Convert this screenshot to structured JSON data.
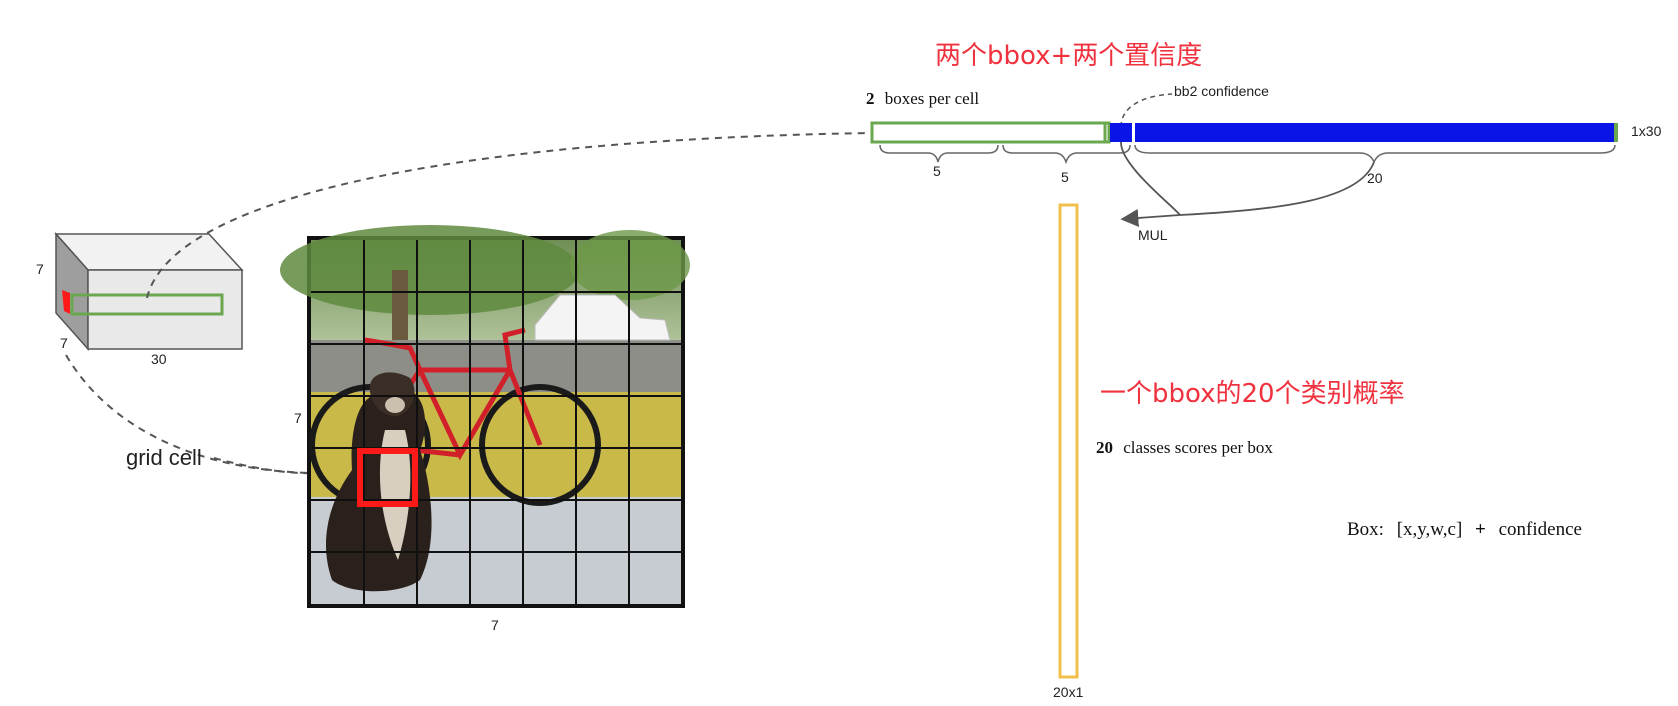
{
  "colors": {
    "green": "#6aa84f",
    "blue": "#0a14e6",
    "orange": "#f2c04a",
    "red": "#ff1a1a",
    "annotation_red": "#f0323f",
    "dashed": "#555555"
  },
  "cube": {
    "height_label": "7",
    "depth_label": "7",
    "width_label": "30"
  },
  "image": {
    "grid_label_y": "7",
    "grid_label_x": "7",
    "grid_cell_label": "grid cell"
  },
  "vector": {
    "title_cn": "两个bbox+两个置信度",
    "boxes_count": "2",
    "boxes_label": "boxes per cell",
    "bb2_label": "bb2 confidence",
    "size_label": "1x30",
    "seg1_label": "5",
    "seg2_label": "5",
    "seg3_label": "20",
    "mul_label": "MUL"
  },
  "class_vector": {
    "title_cn": "一个bbox的20个类别概率",
    "classes_count": "20",
    "classes_label": "classes scores per box",
    "size_label": "20x1"
  },
  "box_formula": {
    "prefix": "Box:",
    "vars": "[x,y,w,c]",
    "plus": "+",
    "suffix": "confidence"
  }
}
